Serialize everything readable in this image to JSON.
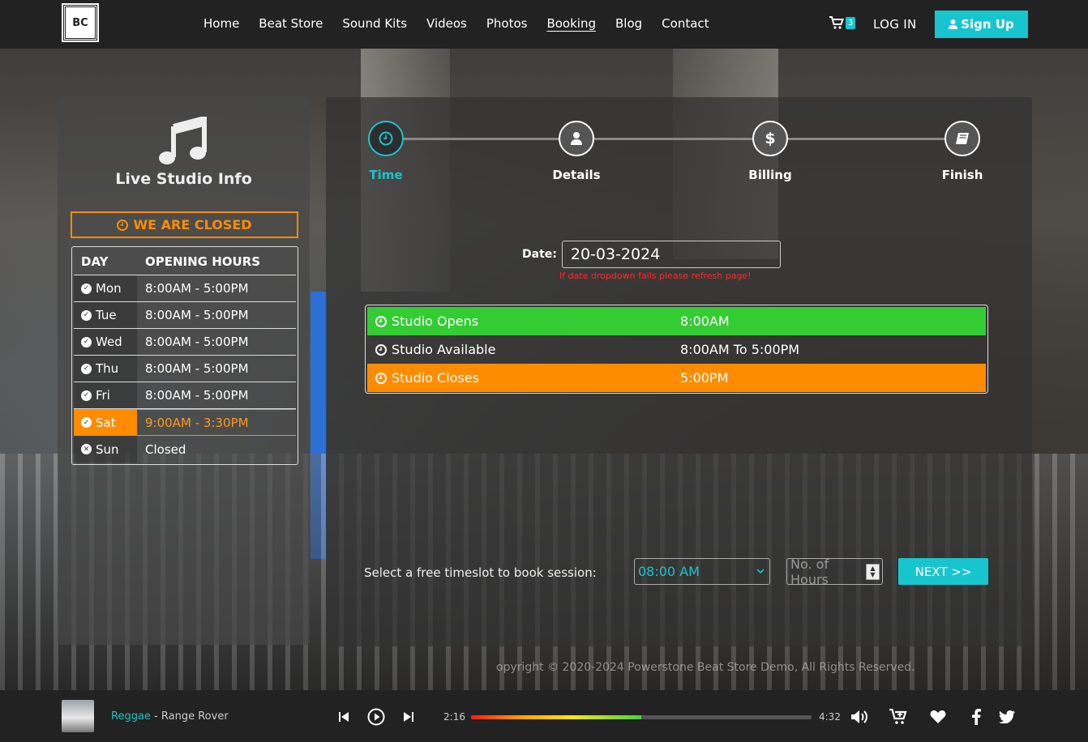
{
  "nav": {
    "logo": "BC",
    "links": [
      "Home",
      "Beat Store",
      "Sound Kits",
      "Videos",
      "Photos",
      "Booking",
      "Blog",
      "Contact"
    ],
    "active": "Booking",
    "cart_count": "3",
    "login": "LOG IN",
    "signup": "Sign Up"
  },
  "info": {
    "title": "Live Studio Info",
    "status": "WE ARE CLOSED",
    "header_day": "DAY",
    "header_hours": "OPENING HOURS",
    "days": [
      {
        "day": "Mon",
        "hours": "8:00AM - 5:00PM",
        "status": "open"
      },
      {
        "day": "Tue",
        "hours": "8:00AM - 5:00PM",
        "status": "open"
      },
      {
        "day": "Wed",
        "hours": "8:00AM - 5:00PM",
        "status": "open"
      },
      {
        "day": "Thu",
        "hours": "8:00AM - 5:00PM",
        "status": "open"
      },
      {
        "day": "Fri",
        "hours": "8:00AM - 5:00PM",
        "status": "open"
      },
      {
        "day": "Sat",
        "hours": "9:00AM - 3:30PM",
        "status": "open"
      },
      {
        "day": "Sun",
        "hours": "Closed",
        "status": "closed"
      }
    ]
  },
  "steps": [
    {
      "label": "Time",
      "icon": "clock-icon"
    },
    {
      "label": "Details",
      "icon": "user-icon"
    },
    {
      "label": "Billing",
      "icon": "dollar-icon"
    },
    {
      "label": "Finish",
      "icon": "book-icon"
    }
  ],
  "booking": {
    "date_label": "Date:",
    "date_value": "20-03-2024",
    "date_warning": "If date dropdown fails please refresh page!",
    "slots": [
      {
        "name": "Studio Opens",
        "time": "8:00AM"
      },
      {
        "name": "Studio Available",
        "time": "8:00AM To 5:00PM"
      },
      {
        "name": "Studio Closes",
        "time": "5:00PM"
      }
    ],
    "prompt": "Select a free timeslot to book session:",
    "time_selected": "08:00 AM",
    "hours_placeholder": "No. of Hours",
    "next": "NEXT >>"
  },
  "footer": {
    "copyright": "opyright © 2020-2024 Powerstone Beat Store Demo, All Rights Reserved."
  },
  "player": {
    "genre": "Reggae",
    "separator": " - ",
    "title": "Range Rover",
    "current": "2:16",
    "total": "4:32",
    "progress": 0.5
  },
  "colors": {
    "accent": "#18c5cf",
    "open": "#33cc33",
    "closed": "#ff8c00"
  }
}
